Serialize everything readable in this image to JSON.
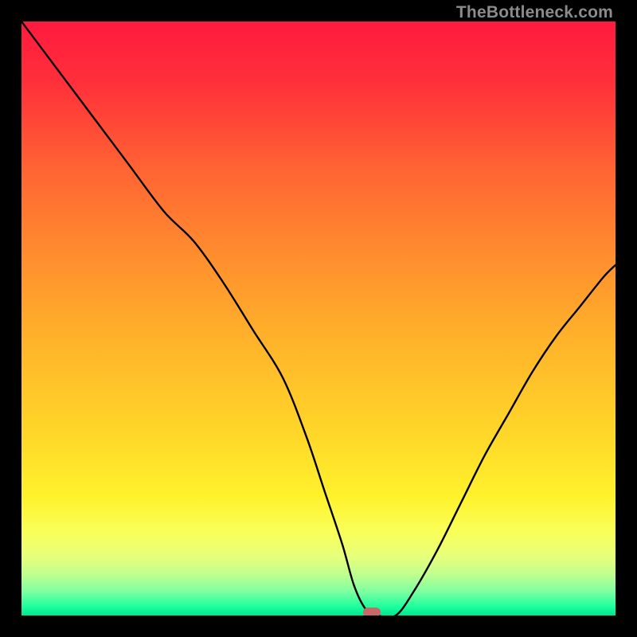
{
  "watermark": "TheBottleneck.com",
  "chart_data": {
    "type": "line",
    "title": "",
    "xlabel": "",
    "ylabel": "",
    "xlim": [
      0,
      100
    ],
    "ylim": [
      0,
      100
    ],
    "grid": false,
    "legend": false,
    "series": [
      {
        "name": "bottleneck-curve",
        "x": [
          0,
          6,
          12,
          18,
          24,
          29,
          34,
          39,
          44,
          48,
          51,
          54,
          56,
          58,
          60,
          63,
          66,
          70,
          74,
          78,
          82,
          86,
          90,
          94,
          98,
          100
        ],
        "y": [
          100,
          92,
          84,
          76,
          68,
          63,
          56,
          48,
          40,
          30,
          21,
          12,
          5,
          1,
          0,
          0,
          4,
          11,
          19,
          27,
          34,
          41,
          47,
          52,
          57,
          59
        ]
      }
    ],
    "background_gradient": {
      "stops": [
        {
          "offset": 0.0,
          "color": "#ff1a3f"
        },
        {
          "offset": 0.1,
          "color": "#ff2f3a"
        },
        {
          "offset": 0.25,
          "color": "#ff6433"
        },
        {
          "offset": 0.4,
          "color": "#ff8f2e"
        },
        {
          "offset": 0.55,
          "color": "#ffb62a"
        },
        {
          "offset": 0.7,
          "color": "#ffd829"
        },
        {
          "offset": 0.8,
          "color": "#fff22c"
        },
        {
          "offset": 0.86,
          "color": "#f9ff5a"
        },
        {
          "offset": 0.9,
          "color": "#e7ff7a"
        },
        {
          "offset": 0.93,
          "color": "#c1ff8e"
        },
        {
          "offset": 0.96,
          "color": "#7dffa0"
        },
        {
          "offset": 0.985,
          "color": "#1eff9e"
        },
        {
          "offset": 1.0,
          "color": "#00e78f"
        }
      ]
    },
    "marker": {
      "x_pct": 59.0,
      "y_pct": 0.5,
      "color": "#c86868"
    }
  }
}
